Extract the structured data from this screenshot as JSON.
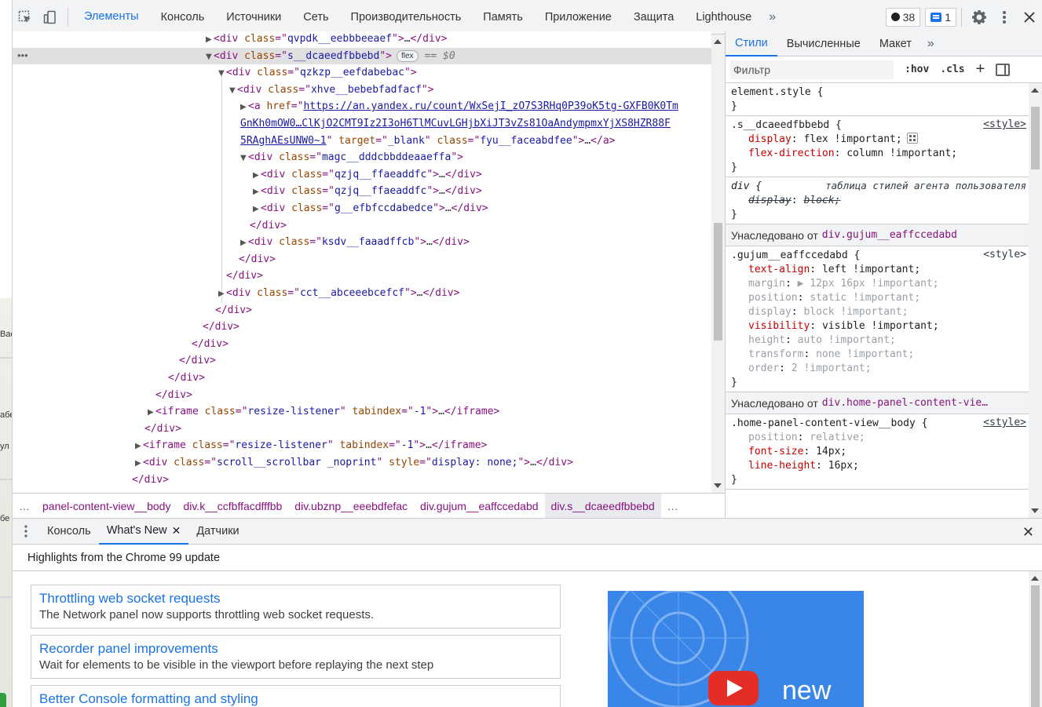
{
  "page_sliver": {
    "labels": [
      "Вас",
      "абе",
      "ул",
      "бе"
    ]
  },
  "toolbar": {
    "tabs": [
      "Элементы",
      "Консоль",
      "Источники",
      "Сеть",
      "Производительность",
      "Память",
      "Приложение",
      "Защита",
      "Lighthouse"
    ],
    "more": "»",
    "errors_count": "38",
    "messages_count": "1"
  },
  "elements": {
    "lines": [
      {
        "tri": "▶",
        "tag": "div",
        "attrs": [
          [
            "class",
            "qvpdk__eebbbeeaef"
          ]
        ],
        "collapsed": true
      },
      {
        "tri": "▼",
        "tag": "div",
        "attrs": [
          [
            "class",
            "s__dcaeedfbbebd"
          ]
        ],
        "badge": "flex",
        "eq": "== $0"
      },
      {
        "tri": "▼",
        "tag": "div",
        "attrs": [
          [
            "class",
            "qzkzp__eefdabebac"
          ]
        ]
      },
      {
        "tri": "▼",
        "tag": "div",
        "attrs": [
          [
            "class",
            "xhve__bebebfadfacf"
          ]
        ]
      },
      {
        "tri": "▶",
        "tag": "a",
        "href1": "https://an.yandex.ru/count/WxSejI_zO7S3RHq0P39oK5tg-GXFB0K0Tm"
      },
      {
        "href2": "GnKh0mOW0…ClKjO2CMT9Iz2I3oH6TlMCuvLGHjbXiJT3vZs81OaAndympmxYjXS8HZR88F"
      },
      {
        "href3": "5RAghAEsUNW0~1",
        "attrs": [
          [
            "target",
            "_blank"
          ],
          [
            "class",
            "fyu__faceabdfee"
          ]
        ],
        "end": "…</a>"
      },
      {
        "tri": "▼",
        "tag": "div",
        "attrs": [
          [
            "class",
            "magc__dddcbbddeaaeffa"
          ]
        ]
      },
      {
        "tri": "▶",
        "tag": "div",
        "attrs": [
          [
            "class",
            "qzjq__ffaeaddfc"
          ]
        ],
        "collapsed": true
      },
      {
        "tri": "▶",
        "tag": "div",
        "attrs": [
          [
            "class",
            "qzjq__ffaeaddfc"
          ]
        ],
        "collapsed": true
      },
      {
        "tri": "▶",
        "tag": "div",
        "attrs": [
          [
            "class",
            "g__efbfccdabedce"
          ]
        ],
        "collapsed": true
      },
      {
        "close": "</div>"
      },
      {
        "tri": "▶",
        "tag": "div",
        "attrs": [
          [
            "class",
            "ksdv__faaadffcb"
          ]
        ],
        "collapsed": true
      },
      {
        "close": "</div>"
      },
      {
        "close": "</div>"
      },
      {
        "tri": "▶",
        "tag": "div",
        "attrs": [
          [
            "class",
            "cct__abceeebcefcf"
          ]
        ],
        "collapsed": true
      },
      {
        "close": "</div>"
      },
      {
        "close": "</div>"
      },
      {
        "close": "</div>"
      },
      {
        "close": "</div>"
      },
      {
        "close": "</div>"
      },
      {
        "close": "</div>"
      },
      {
        "tri": "▶",
        "tag": "iframe",
        "attrs": [
          [
            "class",
            "resize-listener"
          ],
          [
            "tabindex",
            "-1"
          ]
        ],
        "collapsed": true,
        "endtag": "iframe"
      },
      {
        "close": "</div>"
      },
      {
        "tri": "▶",
        "tag": "iframe",
        "attrs": [
          [
            "class",
            "resize-listener"
          ],
          [
            "tabindex",
            "-1"
          ]
        ],
        "collapsed": true,
        "endtag": "iframe"
      },
      {
        "tri": "▶",
        "tag": "div",
        "attrs": [
          [
            "class",
            "scroll__scrollbar _noprint"
          ],
          [
            "style",
            "display: none;"
          ]
        ],
        "collapsed": true
      },
      {
        "close": "</div>"
      }
    ]
  },
  "breadcrumb": {
    "items": [
      "…",
      "panel-content-view__body",
      "div.k__ccfbffacdfffbb",
      "div.ubznp__eeebdfefac",
      "div.gujum__eaffccedabd",
      "div.s__dcaeedfbbebd",
      "…"
    ]
  },
  "styles": {
    "tabs": [
      "Стили",
      "Вычисленные",
      "Макет"
    ],
    "more": "»",
    "filter_placeholder": "Фильтр",
    "hov": ":hov",
    "cls": ".cls",
    "plus": "+",
    "element_style": "element.style {",
    "close_brace": "}",
    "rule1": {
      "selector": ".s__dcaeedfbbebd {",
      "source": "<style>",
      "decls": [
        [
          "display",
          "flex !important;"
        ],
        [
          "flex-direction",
          "column !important;"
        ]
      ]
    },
    "rule2": {
      "selector": "div {",
      "source": "таблица стилей агента пользователя",
      "decls": [
        [
          "display",
          "block;"
        ]
      ]
    },
    "inherited1": {
      "label": "Унаследовано от",
      "from": "div.gujum__eaffccedabd"
    },
    "rule3": {
      "selector": ".gujum__eaffccedabd {",
      "source": "<style>",
      "decls": [
        [
          "text-align",
          "left !important;",
          false
        ],
        [
          "margin",
          "▶ 12px 16px !important;",
          true
        ],
        [
          "position",
          "static !important;",
          true
        ],
        [
          "display",
          "block !important;",
          true
        ],
        [
          "visibility",
          "visible !important;",
          false
        ],
        [
          "height",
          "auto !important;",
          true
        ],
        [
          "transform",
          "none !important;",
          true
        ],
        [
          "order",
          "2 !important;",
          true
        ]
      ]
    },
    "inherited2": {
      "label": "Унаследовано от",
      "from": "div.home-panel-content-vie…"
    },
    "rule4": {
      "selector": ".home-panel-content-view__body {",
      "source": "<style>",
      "decls": [
        [
          "position",
          "relative;",
          true
        ],
        [
          "font-size",
          "14px;",
          false
        ],
        [
          "line-height",
          "16px;",
          false
        ]
      ]
    }
  },
  "drawer": {
    "tabs": [
      "Консоль",
      "What's New",
      "Датчики"
    ],
    "active_close": "✕",
    "close": "✕"
  },
  "whatsnew": {
    "header": "Highlights from the Chrome 99 update",
    "cards": [
      {
        "title": "Throttling web socket requests",
        "desc": "The Network panel now supports throttling web socket requests."
      },
      {
        "title": "Recorder panel improvements",
        "desc": "Wait for elements to be visible in the viewport before replaying the next step"
      },
      {
        "title": "Better Console formatting and styling",
        "desc": ""
      }
    ],
    "video_label": "new"
  },
  "colors": {
    "accent": "#1a73e8",
    "tag": "#881280",
    "attr_name": "#994500",
    "attr_value": "#1a1aa6",
    "prop_name": "#c80000"
  }
}
